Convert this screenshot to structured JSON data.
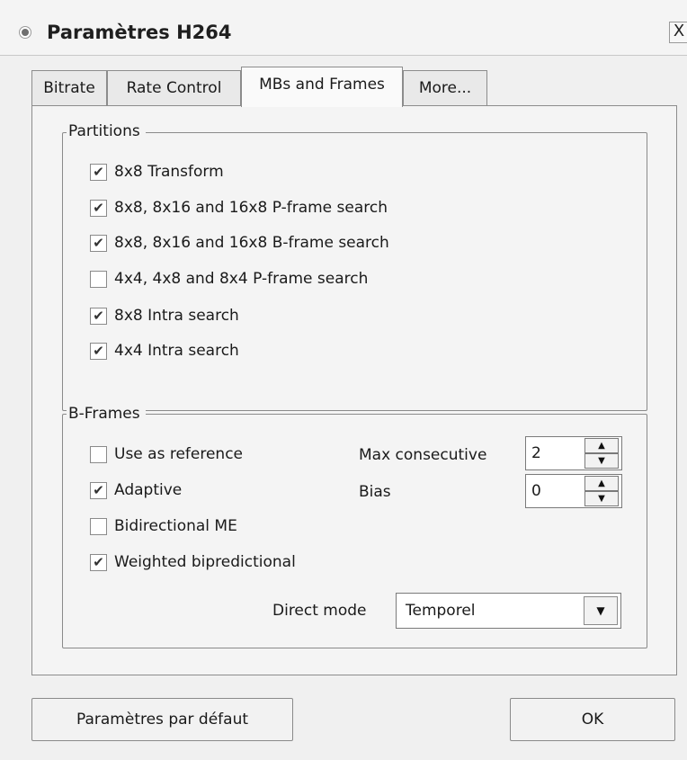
{
  "window": {
    "title": "Paramètres H264",
    "close_glyph": "X"
  },
  "tabs": [
    {
      "label": "Bitrate",
      "active": false
    },
    {
      "label": "Rate Control",
      "active": false
    },
    {
      "label": "MBs and Frames",
      "active": true
    },
    {
      "label": "More...",
      "active": false
    }
  ],
  "partitions": {
    "title": "Partitions",
    "options": [
      {
        "label": "8x8 Transform",
        "checked": true
      },
      {
        "label": "8x8, 8x16 and 16x8 P-frame search",
        "checked": true
      },
      {
        "label": "8x8, 8x16 and 16x8 B-frame search",
        "checked": true
      },
      {
        "label": "4x4, 4x8 and 8x4 P-frame search",
        "checked": false
      },
      {
        "label": "8x8 Intra search",
        "checked": true
      },
      {
        "label": "4x4 Intra search",
        "checked": true
      }
    ]
  },
  "bframes": {
    "title": "B-Frames",
    "options": [
      {
        "label": "Use as reference",
        "checked": false
      },
      {
        "label": "Adaptive",
        "checked": true
      },
      {
        "label": "Bidirectional ME",
        "checked": false
      },
      {
        "label": "Weighted bipredictional",
        "checked": true
      }
    ],
    "max_consecutive": {
      "label": "Max consecutive",
      "value": "2"
    },
    "bias": {
      "label": "Bias",
      "value": "0"
    },
    "direct_mode": {
      "label": "Direct mode",
      "value": "Temporel"
    }
  },
  "buttons": {
    "defaults": "Paramètres par défaut",
    "ok": "OK"
  },
  "glyphs": {
    "check": "✔",
    "up": "▲",
    "down": "▼"
  },
  "colors": {
    "border": "#8c8c8c",
    "background": "#f0f0f0",
    "field": "#ffffff"
  }
}
